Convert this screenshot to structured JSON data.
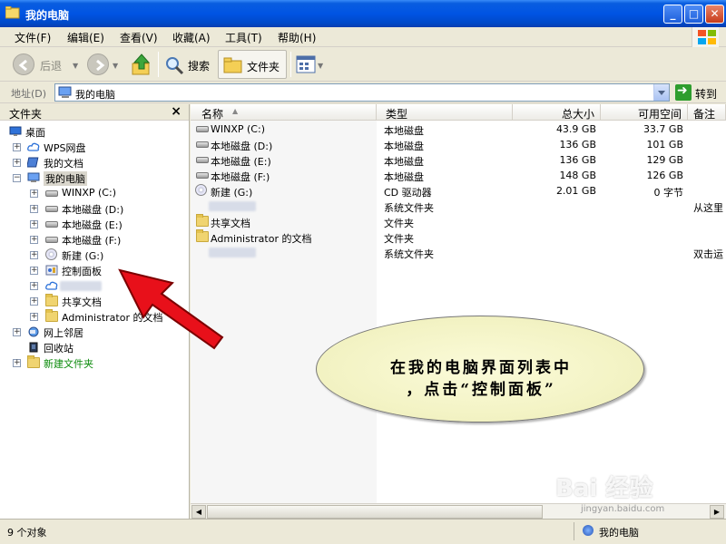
{
  "window": {
    "title": "我的电脑"
  },
  "menu": [
    "文件(F)",
    "编辑(E)",
    "查看(V)",
    "收藏(A)",
    "工具(T)",
    "帮助(H)"
  ],
  "toolbar": {
    "back": "后退",
    "search": "搜索",
    "folders": "文件夹"
  },
  "address": {
    "label": "地址(D)",
    "value": "我的电脑",
    "go": "转到"
  },
  "folder_pane": {
    "title": "文件夹",
    "close": "×",
    "tree": [
      {
        "label": "桌面",
        "icon": "desktop-icon"
      },
      {
        "label": "WPS网盘",
        "icon": "cloud-icon"
      },
      {
        "label": "我的文档",
        "icon": "documents-icon"
      },
      {
        "label": "我的电脑",
        "icon": "computer-icon"
      },
      {
        "label": "WINXP (C:)",
        "icon": "drive-icon"
      },
      {
        "label": "本地磁盘 (D:)",
        "icon": "drive-icon"
      },
      {
        "label": "本地磁盘 (E:)",
        "icon": "drive-icon"
      },
      {
        "label": "本地磁盘 (F:)",
        "icon": "drive-icon"
      },
      {
        "label": "新建 (G:)",
        "icon": "cd-drive-icon"
      },
      {
        "label": "控制面板",
        "icon": "control-panel-icon"
      },
      {
        "label": "",
        "icon": "cloud-icon"
      },
      {
        "label": "共享文档",
        "icon": "folder-icon"
      },
      {
        "label": "Administrator 的文档",
        "icon": "folder-icon"
      },
      {
        "label": "网上邻居",
        "icon": "network-icon"
      },
      {
        "label": "回收站",
        "icon": "recycle-bin-icon"
      },
      {
        "label": "新建文件夹",
        "icon": "folder-icon"
      }
    ]
  },
  "list": {
    "columns": [
      "名称",
      "类型",
      "总大小",
      "可用空间",
      "备注"
    ],
    "rows": [
      {
        "name": "WINXP (C:)",
        "type": "本地磁盘",
        "total": "43.9 GB",
        "free": "33.7 GB",
        "note": ""
      },
      {
        "name": "本地磁盘 (D:)",
        "type": "本地磁盘",
        "total": "136 GB",
        "free": "101 GB",
        "note": ""
      },
      {
        "name": "本地磁盘 (E:)",
        "type": "本地磁盘",
        "total": "136 GB",
        "free": "129 GB",
        "note": ""
      },
      {
        "name": "本地磁盘 (F:)",
        "type": "本地磁盘",
        "total": "148 GB",
        "free": "126 GB",
        "note": ""
      },
      {
        "name": "新建 (G:)",
        "type": "CD 驱动器",
        "total": "2.01 GB",
        "free": "0 字节",
        "note": ""
      },
      {
        "name": "",
        "type": "系统文件夹",
        "total": "",
        "free": "",
        "note": "从这里"
      },
      {
        "name": "共享文档",
        "type": "文件夹",
        "total": "",
        "free": "",
        "note": ""
      },
      {
        "name": "Administrator 的文档",
        "type": "文件夹",
        "total": "",
        "free": "",
        "note": ""
      },
      {
        "name": "",
        "type": "系统文件夹",
        "total": "",
        "free": "",
        "note": "双击运"
      }
    ]
  },
  "status": {
    "left": "9 个对象",
    "right": "我的电脑"
  },
  "annotation": {
    "line1": "在我的电脑界面列表中",
    "line2": "，点击“控制面板”"
  },
  "watermark": {
    "text": "Bai 经验",
    "sub": "jingyan.baidu.com"
  },
  "colors": {
    "titlebar": "#0054e3",
    "arrow": "#e8101a",
    "callout": "#f5f5c8"
  }
}
